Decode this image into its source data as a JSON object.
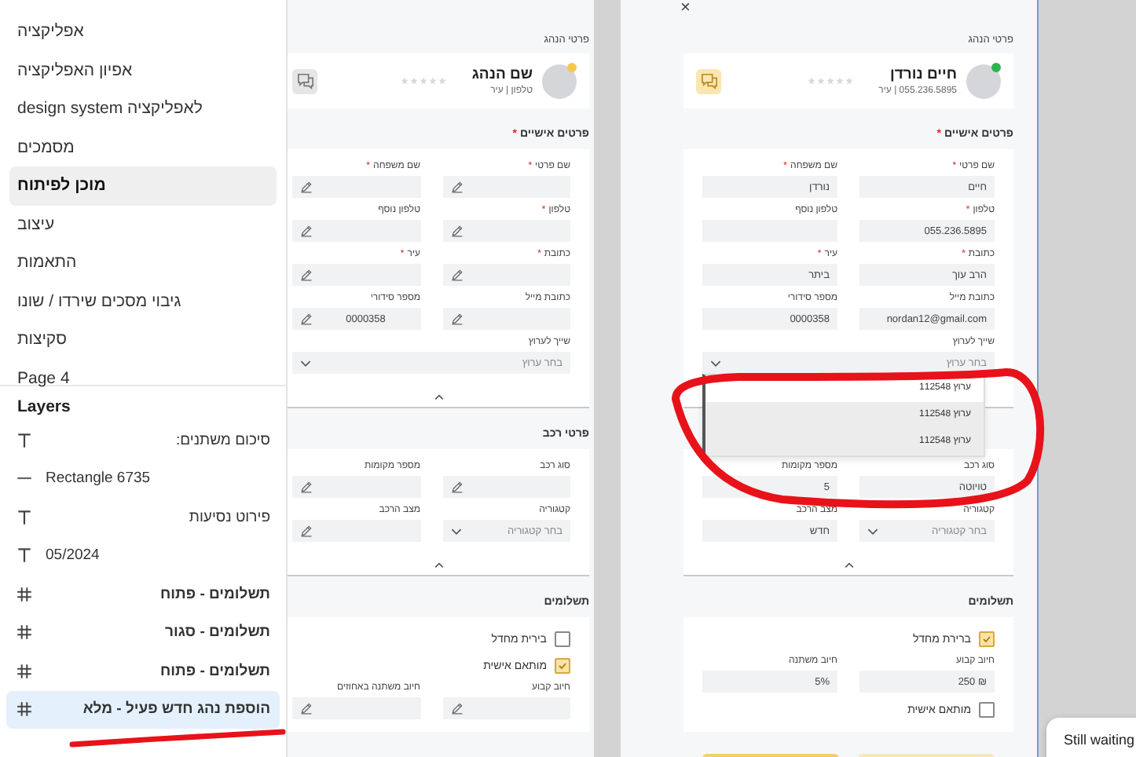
{
  "pages_panel": {
    "pages": [
      {
        "label": "אפליקציה",
        "selected": false
      },
      {
        "label": "אפיון האפליקציה",
        "selected": false
      },
      {
        "label": "design system לאפליקציה",
        "selected": false
      },
      {
        "label": "מסמכים",
        "selected": false
      },
      {
        "label": "מוכן לפיתוח",
        "selected": true
      },
      {
        "label": "עיצוב",
        "selected": false
      },
      {
        "label": "התאמות",
        "selected": false
      },
      {
        "label": "גיבוי מסכים שירדו / שונו",
        "selected": false
      },
      {
        "label": "סקיצות",
        "selected": false
      },
      {
        "label": "Page 4",
        "selected": false
      }
    ]
  },
  "layers_panel": {
    "title": "Layers",
    "layers": [
      {
        "kind": "text",
        "label": "סיכום משתנים:",
        "selected": false
      },
      {
        "kind": "line",
        "label": "Rectangle 6735",
        "selected": false
      },
      {
        "kind": "text",
        "label": "פירוט נסיעות",
        "selected": false
      },
      {
        "kind": "text",
        "label": "05/2024",
        "selected": false
      },
      {
        "kind": "frame",
        "label": "תשלומים - פתוח",
        "selected": false
      },
      {
        "kind": "frame",
        "label": "תשלומים - סגור",
        "selected": false
      },
      {
        "kind": "frame",
        "label": "תשלומים - פתוח",
        "selected": false
      },
      {
        "kind": "frame",
        "label": "הוספת נהג חדש פעיל - מלא",
        "selected": true
      }
    ]
  },
  "frames": [
    {
      "close": "×",
      "header_title": "פרטי הנהג",
      "driver": {
        "name": "חיים נורדן",
        "subtitle": "055.236.5895 | עיר",
        "color": "#2fb350",
        "stars": 0,
        "chat_highlighted": true
      },
      "sections": [
        {
          "title": "פרטים אישיים",
          "required_mark": "*",
          "collapsible": true,
          "items": [
            {
              "kind": "field",
              "label": "שם פרטי",
              "required_mark": "*",
              "value": "חיים",
              "editable": false
            },
            {
              "kind": "field",
              "label": "שם משפחה",
              "required_mark": "*",
              "value": "נורדן",
              "editable": false
            },
            {
              "kind": "field",
              "label": "טלפון",
              "required_mark": "*",
              "value": "055.236.5895",
              "editable": false
            },
            {
              "kind": "field",
              "label": "טלפון נוסף",
              "editable": false
            },
            {
              "kind": "field",
              "label": "כתובת",
              "required_mark": "*",
              "value": "הרב עוך",
              "editable": false
            },
            {
              "kind": "field",
              "label": "עיר",
              "required_mark": "*",
              "value": "ביתר",
              "editable": false
            },
            {
              "kind": "field",
              "label": "כתובת מייל",
              "value": "nordan12@gmail.com",
              "editable": false
            },
            {
              "kind": "field",
              "label": "מספר סידורי",
              "value": "0000358",
              "editable": false
            },
            {
              "kind": "select",
              "label": "שייך לערוץ",
              "placeholder": "בחר ערוץ",
              "wide": true,
              "expanded": true,
              "options": [
                {
                  "label": "ערוץ 112548",
                  "selected": true
                },
                {
                  "label": "ערוץ 112548",
                  "selected": false
                },
                {
                  "label": "ערוץ 112548",
                  "selected": false
                }
              ]
            }
          ]
        },
        {
          "collapsible": true,
          "items": [
            {
              "kind": "field",
              "label": "סוג רכב",
              "value": "טויוטה",
              "editable": false
            },
            {
              "kind": "field",
              "label": "מספר מקומות",
              "value": "5",
              "editable": false
            },
            {
              "kind": "select",
              "label": "קטגוריה",
              "placeholder": "בחר קטגוריה",
              "wide": false
            },
            {
              "kind": "field",
              "label": "מצב הרכב",
              "value": "חדש",
              "editable": false
            }
          ]
        },
        {
          "title": "תשלומים",
          "collapsible": false,
          "items": [
            {
              "kind": "checkbox",
              "label": "ברירת מחדל",
              "checked": true
            },
            {
              "kind": "field",
              "label": "חיוב קבוע",
              "value": "₪ 250",
              "editable": false
            },
            {
              "kind": "field",
              "label": "חיוב משתנה",
              "value": "5%",
              "editable": false
            },
            {
              "kind": "checkbox",
              "label": "מותאם אישית",
              "checked": false
            }
          ]
        }
      ],
      "buttons": [
        {
          "kind": "secondary"
        },
        {
          "kind": "primary"
        }
      ]
    },
    {
      "header_title": "פרטי הנהג",
      "driver": {
        "name": "שם הנהג",
        "subtitle": "טלפון | עיר",
        "color": "#f2c94c",
        "stars": 0,
        "chat_highlighted": false
      },
      "sections": [
        {
          "title": "פרטים אישיים",
          "required_mark": "*",
          "collapsible": true,
          "items": [
            {
              "kind": "field",
              "label": "שם פרטי",
              "required_mark": "*",
              "editable": true
            },
            {
              "kind": "field",
              "label": "שם משפחה",
              "required_mark": "*",
              "editable": true
            },
            {
              "kind": "field",
              "label": "טלפון",
              "required_mark": "*",
              "editable": true
            },
            {
              "kind": "field",
              "label": "טלפון נוסף",
              "editable": true
            },
            {
              "kind": "field",
              "label": "כתובת",
              "required_mark": "*",
              "editable": true
            },
            {
              "kind": "field",
              "label": "עיר",
              "required_mark": "*",
              "editable": true
            },
            {
              "kind": "field",
              "label": "כתובת מייל",
              "editable": true
            },
            {
              "kind": "field",
              "label": "מספר סידורי",
              "value": "0000358",
              "editable": true
            },
            {
              "kind": "select",
              "label": "שייך לערוץ",
              "placeholder": "בחר ערוץ",
              "wide": true
            }
          ]
        },
        {
          "title": "פרטי רכב",
          "collapsible": true,
          "items": [
            {
              "kind": "field",
              "label": "סוג רכב",
              "editable": true
            },
            {
              "kind": "field",
              "label": "מספר מקומות",
              "editable": true
            },
            {
              "kind": "select",
              "label": "קטגוריה",
              "placeholder": "בחר קטגוריה",
              "wide": false
            },
            {
              "kind": "field",
              "label": "מצב הרכב",
              "editable": true
            }
          ]
        },
        {
          "title": "תשלומים",
          "collapsible": false,
          "items": [
            {
              "kind": "checkbox",
              "label": "בירית מחדל",
              "checked": false
            },
            {
              "kind": "checkbox",
              "label": "מותאם אישית",
              "checked": true
            },
            {
              "kind": "field",
              "label": "חיוב קבוע",
              "editable": true
            },
            {
              "kind": "field",
              "label": "חיוב משתנה באחוזים",
              "editable": true
            }
          ]
        }
      ]
    }
  ],
  "annotations": {
    "circle_around_dropdown": true,
    "underline_under_layer": true
  },
  "toast": {
    "text": "Still waiting"
  }
}
